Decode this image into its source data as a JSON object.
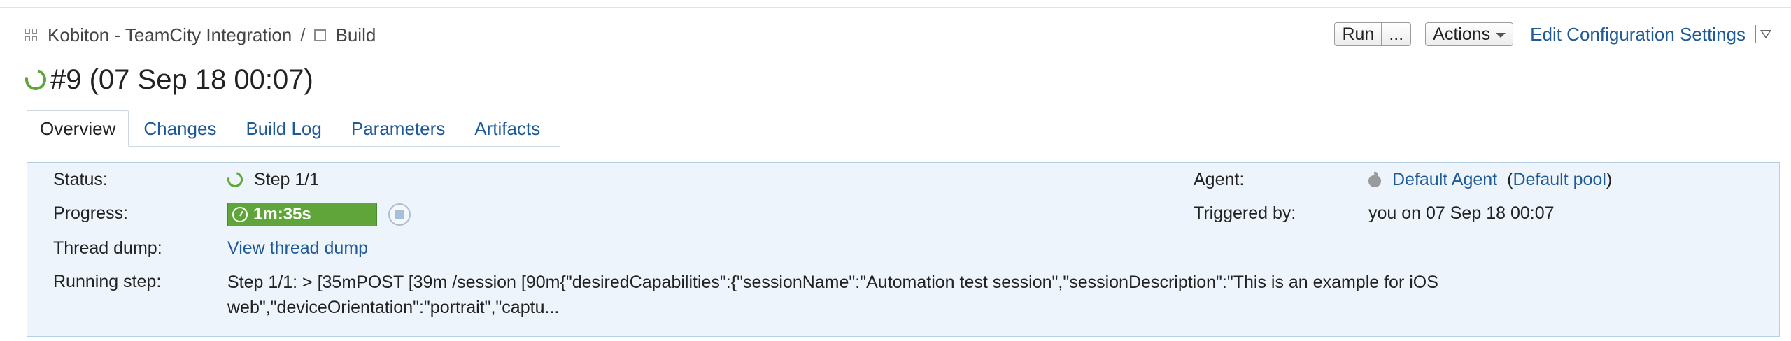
{
  "breadcrumb": {
    "project": "Kobiton - TeamCity Integration",
    "separator": "/",
    "build_config": "Build"
  },
  "build": {
    "title": "#9 (07 Sep 18 00:07)"
  },
  "header": {
    "run_label": "Run",
    "run_more_label": "...",
    "actions_label": "Actions",
    "edit_settings_label": "Edit Configuration Settings"
  },
  "tabs": [
    {
      "label": "Overview",
      "active": true
    },
    {
      "label": "Changes",
      "active": false
    },
    {
      "label": "Build Log",
      "active": false
    },
    {
      "label": "Parameters",
      "active": false
    },
    {
      "label": "Artifacts",
      "active": false
    }
  ],
  "details": {
    "status_label": "Status:",
    "status_value": "Step 1/1",
    "progress_label": "Progress:",
    "progress_value": "1m:35s",
    "thread_dump_label": "Thread dump:",
    "thread_dump_link": "View thread dump",
    "running_step_label": "Running step:",
    "running_step_value": "Step 1/1: > [35mPOST [39m /session [90m{\"desiredCapabilities\":{\"sessionName\":\"Automation test session\",\"sessionDescription\":\"This is an example for iOS web\",\"deviceOrientation\":\"portrait\",\"captu...",
    "agent_label": "Agent:",
    "agent_name": "Default Agent",
    "agent_pool_open": "(",
    "agent_pool": "Default pool",
    "agent_pool_close": ")",
    "triggered_label": "Triggered by:",
    "triggered_value": "you on 07 Sep 18 00:07"
  },
  "colors": {
    "link": "#1f5a98",
    "success_green": "#5fa53a",
    "panel_bg": "#edf4fb",
    "panel_border": "#b5cfe7"
  },
  "icons": [
    "project-grid-icon",
    "build-config-icon",
    "running-spinner-icon",
    "stopwatch-icon",
    "stop-icon",
    "apple-icon",
    "dropdown-caret-icon"
  ]
}
